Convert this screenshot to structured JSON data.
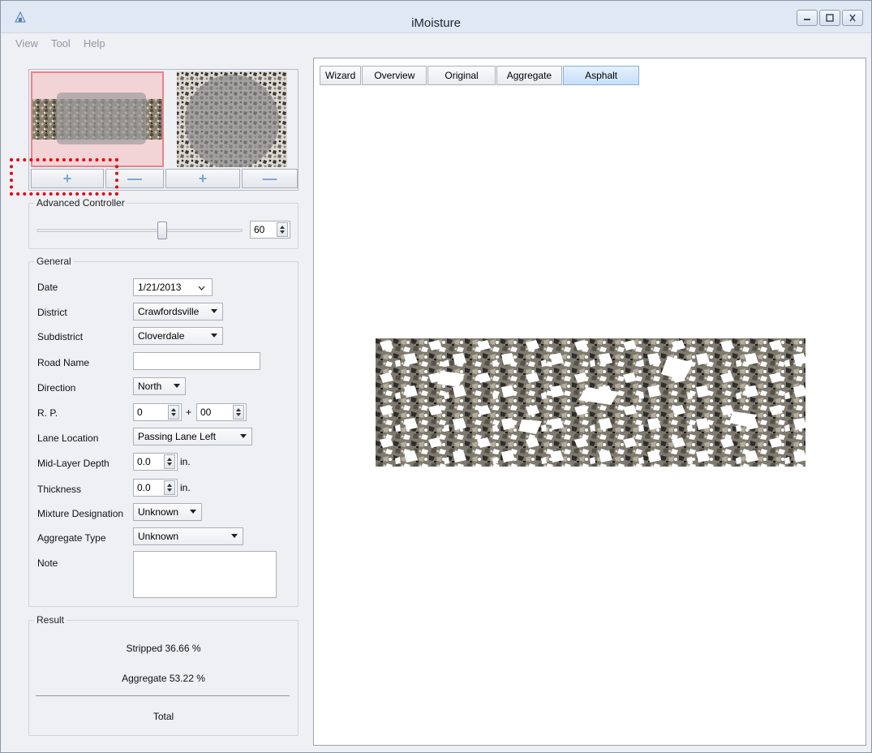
{
  "window": {
    "title": "iMoisture"
  },
  "menu": [
    "View",
    "Tool",
    "Help"
  ],
  "thumbnails": {
    "buttons": {
      "plus": "+",
      "minus": "—"
    }
  },
  "advanced_controller": {
    "title": "Advanced Controller",
    "value": "60"
  },
  "general": {
    "title": "General",
    "date": {
      "label": "Date",
      "value": "1/21/2013"
    },
    "district": {
      "label": "District",
      "value": "Crawfordsville"
    },
    "subdistrict": {
      "label": "Subdistrict",
      "value": "Cloverdale"
    },
    "road_name": {
      "label": "Road Name",
      "value": ""
    },
    "direction": {
      "label": "Direction",
      "value": "North"
    },
    "rp": {
      "label": "R. P.",
      "value1": "0",
      "plus": "+",
      "value2": "00"
    },
    "lane_location": {
      "label": "Lane Location",
      "value": "Passing Lane Left"
    },
    "mid_layer_depth": {
      "label": "Mid-Layer Depth",
      "value": "0.0",
      "unit": "in."
    },
    "thickness": {
      "label": "Thickness",
      "value": "0.0",
      "unit": "in."
    },
    "mixture_designation": {
      "label": "Mixture Designation",
      "value": "Unknown"
    },
    "aggregate_type": {
      "label": "Aggregate Type",
      "value": "Unknown"
    },
    "note": {
      "label": "Note",
      "value": ""
    }
  },
  "result": {
    "title": "Result",
    "stripped": "Stripped  36.66 %",
    "aggregate": "Aggregate  53.22 %",
    "total": "Total"
  },
  "tabs": [
    "Wizard",
    "Overview",
    "Original",
    "Aggregate",
    "Asphalt"
  ],
  "active_tab": "Asphalt",
  "colors": {
    "accent": "#c7defa",
    "highlight": "#e40613"
  }
}
